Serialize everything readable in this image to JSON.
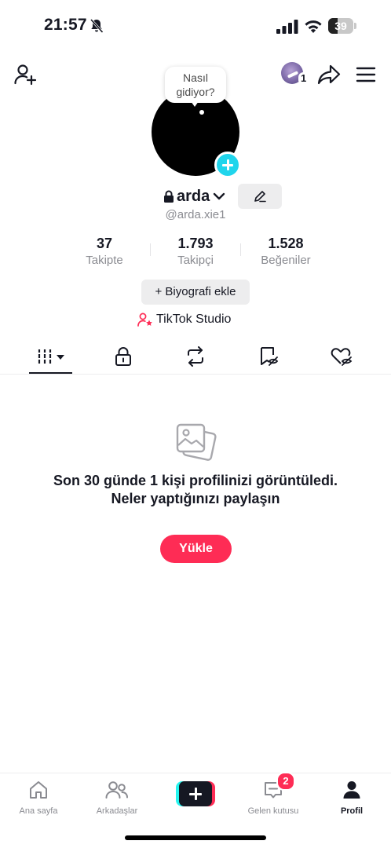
{
  "status_bar": {
    "time": "21:57",
    "battery_level": "39",
    "battery_fraction": 0.39
  },
  "top_bar": {
    "account_count": "1"
  },
  "profile": {
    "note_bubble": "Nasıl gidiyor?",
    "username": "arda",
    "handle": "@arda.xie1",
    "stats": [
      {
        "value": "37",
        "label": "Takipte"
      },
      {
        "value": "1.793",
        "label": "Takipçi"
      },
      {
        "value": "1.528",
        "label": "Beğeniler"
      }
    ],
    "add_bio_label": "+ Biyografi ekle",
    "studio_label": "TikTok Studio"
  },
  "tabs": [
    {
      "icon": "videos-grid-icon",
      "active": true
    },
    {
      "icon": "lock-icon",
      "active": false
    },
    {
      "icon": "repost-icon",
      "active": false
    },
    {
      "icon": "bookmark-hidden-icon",
      "active": false
    },
    {
      "icon": "liked-hidden-icon",
      "active": false
    }
  ],
  "empty_state": {
    "message": "Son 30 günde 1 kişi profilinizi görüntüledi. Neler yaptığınızı paylaşın",
    "upload_label": "Yükle"
  },
  "bottom_nav": {
    "items": [
      {
        "label": "Ana sayfa",
        "icon": "home-icon"
      },
      {
        "label": "Arkadaşlar",
        "icon": "friends-icon"
      },
      {
        "label": "",
        "icon": "create-plus-icon"
      },
      {
        "label": "Gelen kutusu",
        "icon": "inbox-icon",
        "badge": "2"
      },
      {
        "label": "Profil",
        "icon": "profile-icon",
        "active": true
      }
    ]
  },
  "colors": {
    "accent": "#fe2c55",
    "cyan": "#20d5ec",
    "text": "#161823",
    "secondary_text": "#8a8b91"
  }
}
